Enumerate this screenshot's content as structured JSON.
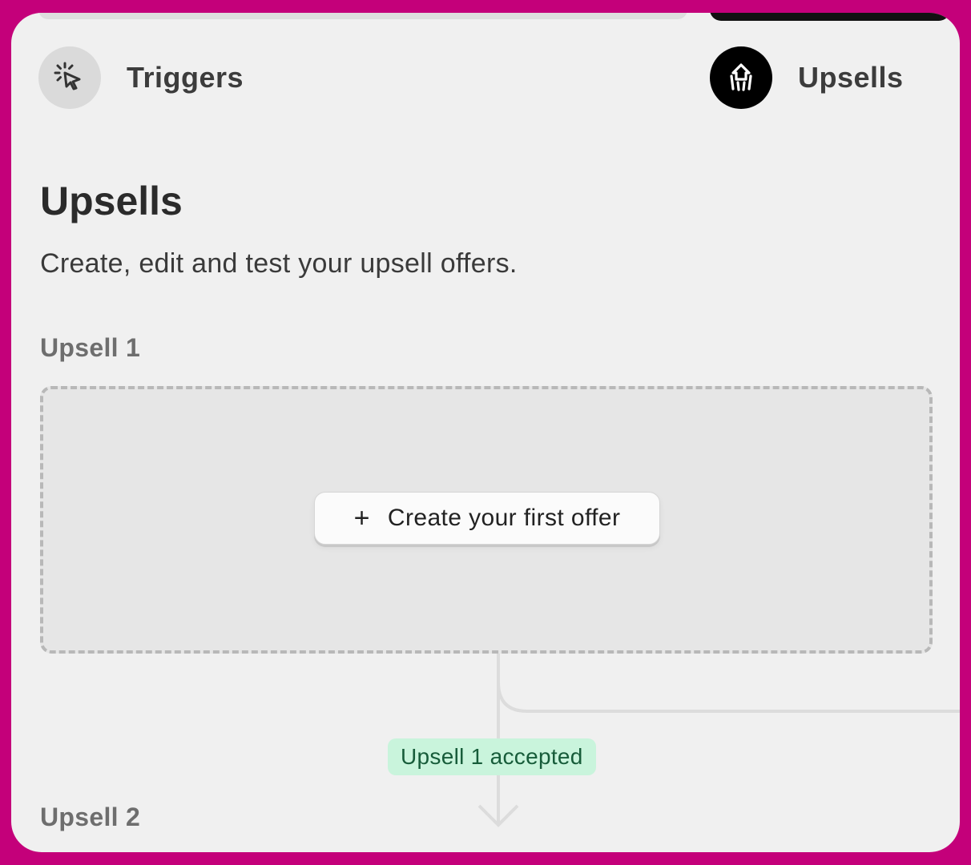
{
  "steps": {
    "triggers": {
      "label": "Triggers",
      "icon": "click-cursor-icon"
    },
    "upsells": {
      "label": "Upsells",
      "icon": "upsell-logo-icon"
    }
  },
  "page": {
    "title": "Upsells",
    "subtitle": "Create, edit and test your upsell offers."
  },
  "upsell1": {
    "label": "Upsell 1",
    "button_plus": "+",
    "button_label": "Create your first offer"
  },
  "flow": {
    "accepted_badge": "Upsell 1 accepted"
  },
  "upsell2": {
    "label": "Upsell 2"
  },
  "colors": {
    "frame": "#c4007a",
    "panel": "#f0f0f0",
    "badge_bg": "#c9f4dc",
    "badge_text": "#175c3a"
  }
}
